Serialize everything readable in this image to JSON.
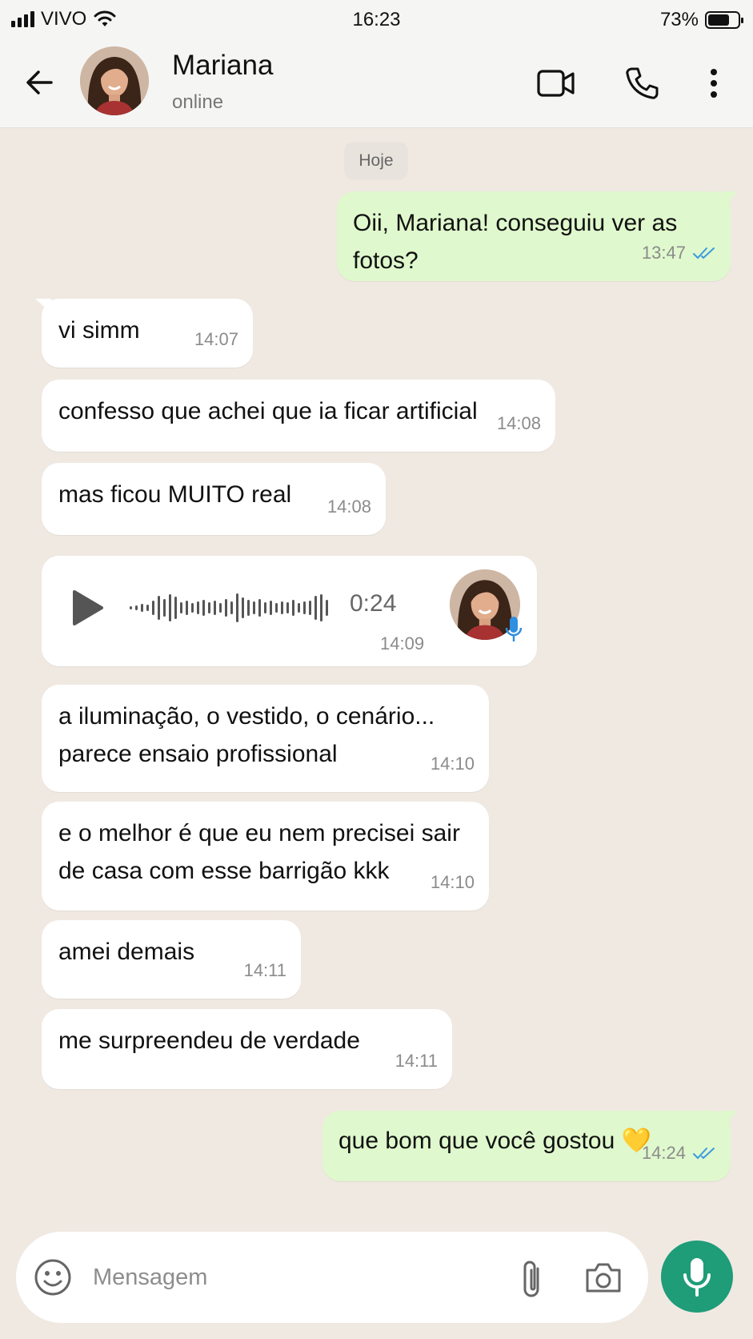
{
  "status_bar": {
    "carrier": "VIVO",
    "time": "16:23",
    "battery_percent": "73%",
    "battery_level": 0.73
  },
  "header": {
    "contact_name": "Mariana",
    "contact_status": "online"
  },
  "chat": {
    "date_chip": "Hoje",
    "messages": [
      {
        "direction": "out",
        "text": "Oii, Mariana! conseguiu ver as fotos?",
        "time": "13:47",
        "read": true
      },
      {
        "direction": "in",
        "text": "vi simm",
        "time": "14:07"
      },
      {
        "direction": "in",
        "text": "confesso que achei que ia ficar artificial",
        "time": "14:08"
      },
      {
        "direction": "in",
        "text": "mas ficou MUITO real",
        "time": "14:08"
      },
      {
        "direction": "in",
        "type": "audio",
        "duration": "0:24",
        "time": "14:09"
      },
      {
        "direction": "in",
        "text": "a iluminação, o vestido, o cenário...\nparece ensaio profissional",
        "time": "14:10"
      },
      {
        "direction": "in",
        "text": "e o melhor é que eu nem precisei sair\nde casa com esse barrigão kkk",
        "time": "14:10"
      },
      {
        "direction": "in",
        "text": "amei demais",
        "time": "14:11"
      },
      {
        "direction": "in",
        "text": "me surpreendeu de verdade",
        "time": "14:11"
      },
      {
        "direction": "out",
        "text": "que bom que você gostou 💛",
        "time": "14:24",
        "read": true
      }
    ]
  },
  "composer": {
    "placeholder": "Mensagem"
  },
  "colors": {
    "accent": "#1f9c78",
    "outgoing_bubble": "#dff8cd",
    "read_ticks": "#3b9be0",
    "background": "#f0e9e2"
  }
}
